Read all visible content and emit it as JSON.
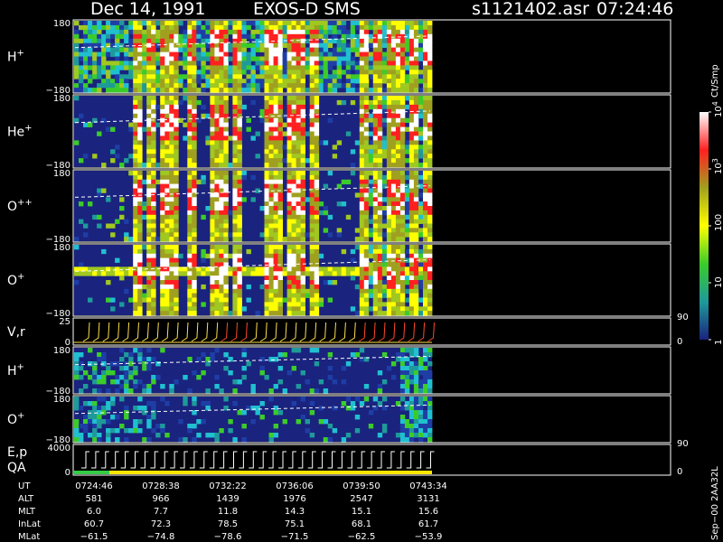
{
  "header": {
    "date": "Dec 14, 1991",
    "instrument": "EXOS-D SMS",
    "file": "s1121402.asr",
    "time": "07:24:46"
  },
  "colors": {
    "background": "#000000",
    "panel_fill": "#1a237e",
    "axis": "#ffffff",
    "trace": "#ffffff",
    "vr_yellow": "#ffe14d",
    "vr_red": "#ff4a2a",
    "qa_green": "#33cc44",
    "qa_yellow": "#ffe600"
  },
  "chart_data": {
    "type": "heatmap",
    "x_range_fraction_with_data": 0.6,
    "panels": [
      {
        "id": "h_plus",
        "label": "H",
        "sup": "+",
        "ymax": "180",
        "ymin": "−180",
        "style": "burst"
      },
      {
        "id": "he_plus",
        "label": "He",
        "sup": "+",
        "ymax": "180",
        "ymin": "−180",
        "style": "burst"
      },
      {
        "id": "o_plusplus",
        "label": "O",
        "sup": "++",
        "ymax": "180",
        "ymin": "−180",
        "style": "burst"
      },
      {
        "id": "o_plus",
        "label": "O",
        "sup": "+",
        "ymax": "180",
        "ymin": "−180",
        "style": "burst-band"
      },
      {
        "id": "vr",
        "label": "V,r",
        "sup": "",
        "ymax": "25",
        "ymin": "0",
        "right_top": "90",
        "right_bottom": "0",
        "style": "hooks"
      },
      {
        "id": "h_plus_2",
        "label": "H",
        "sup": "+",
        "ymax": "180",
        "ymin": "−180",
        "style": "streak"
      },
      {
        "id": "o_plus_2",
        "label": "O",
        "sup": "+",
        "ymax": "180",
        "ymin": "−180",
        "style": "streak"
      },
      {
        "id": "ep",
        "label": "E,p",
        "sup": "",
        "label2": "QA",
        "ymax": "4000",
        "ymin": "0",
        "right_top": "90",
        "right_bottom": "0",
        "style": "steps"
      }
    ],
    "colorbar": {
      "label": "Ct/Smp",
      "ticks": [
        "10",
        "100",
        "10",
        "10",
        "1"
      ],
      "tick_sups": [
        "4",
        "",
        "3",
        "",
        ""
      ],
      "tick_values": [
        10000,
        100,
        1000,
        10,
        1
      ],
      "scale": "log",
      "vmin": 1,
      "vmax": 10000,
      "stops": [
        "#ffffff",
        "#ff2020",
        "#a0a020",
        "#ffff00",
        "#3bcc2a",
        "#1e9a9a",
        "#1a237e"
      ]
    },
    "footer": {
      "rows": [
        {
          "label": "UT",
          "values": [
            "0724:46",
            "0728:38",
            "0732:22",
            "0736:06",
            "0739:50",
            "0743:34"
          ]
        },
        {
          "label": "ALT",
          "values": [
            "581",
            "966",
            "1439",
            "1976",
            "2547",
            "3131"
          ]
        },
        {
          "label": "MLT",
          "values": [
            "6.0",
            "7.7",
            "11.8",
            "14.3",
            "15.1",
            "15.6"
          ]
        },
        {
          "label": "InLat",
          "values": [
            "60.7",
            "72.3",
            "78.5",
            "75.1",
            "68.1",
            "61.7"
          ]
        },
        {
          "label": "MLat",
          "values": [
            "−61.5",
            "−74.8",
            "−78.6",
            "−71.5",
            "−62.5",
            "−53.9"
          ]
        }
      ]
    },
    "side_stamp": "Sep−00  2AA32L"
  }
}
